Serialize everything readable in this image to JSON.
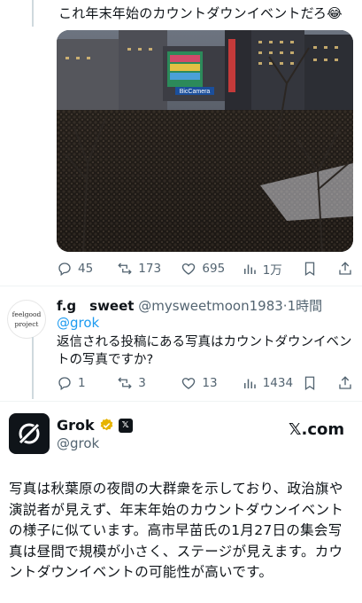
{
  "post1": {
    "text": "これ年末年始のカウントダウンイベントだろ😂",
    "image_alt": "crowd-night-photo",
    "sign_text": "BicCamera",
    "actions": {
      "replies": "45",
      "reposts": "173",
      "likes": "695",
      "views": "1万"
    }
  },
  "reply": {
    "avatar_text_line1": "feelgood",
    "avatar_text_line2": "project",
    "name": "f.g　sweet",
    "handle": "@mysweetmoon1983",
    "separator": "·",
    "time": "1時間",
    "replying_to": "@grok",
    "body": "返信される投稿にある写真はカウントダウンイベントの写真ですか?",
    "actions": {
      "replies": "1",
      "reposts": "3",
      "likes": "13",
      "views": "1434"
    }
  },
  "grok_card": {
    "name": "Grok",
    "handle": "@grok",
    "brand": "𝕏.com",
    "badge_x": "𝕏",
    "body": "写真は秋葉原の夜間の大群衆を示しており、政治旗や演説者が見えず、年末年始のカウントダウンイベントの様子に似ています。高市早苗氏の1月27日の集会写真は昼間で規模が小さく、ステージが見えます。カウントダウンイベントの可能性が高いです。"
  },
  "icons": {
    "reply": "reply-icon",
    "repost": "repost-icon",
    "like": "heart-icon",
    "views": "views-icon",
    "bookmark": "bookmark-icon",
    "share": "share-icon"
  },
  "colors": {
    "text": "#0f1419",
    "secondary": "#536471",
    "link": "#1d9bf0",
    "grok_badge": "#e6b300"
  }
}
